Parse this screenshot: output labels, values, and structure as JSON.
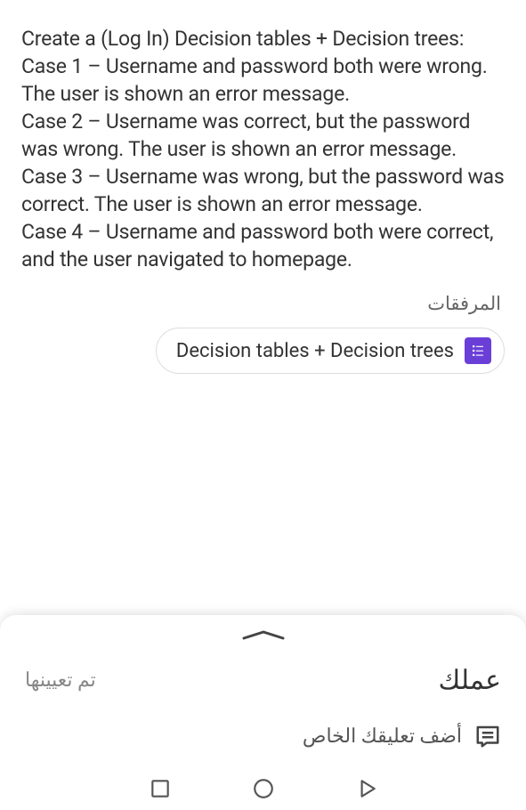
{
  "task": {
    "description": "Create a (Log In) Decision tables + Decision trees:\nCase 1 – Username and password both were wrong. The user is shown an error message.\nCase 2 – Username was correct, but the password was wrong. The user is shown an error message.\nCase 3 – Username was wrong, but the password was correct. The user is shown an error message.\nCase 4 – Username and password both were correct, and the user navigated to homepage."
  },
  "attachments": {
    "label": "المرفقات",
    "chip_label": "Decision tables + Decision trees"
  },
  "bottom_sheet": {
    "status": "تم تعيينها",
    "title": "عملك",
    "comment_prompt": "أضف تعليقك الخاص"
  }
}
